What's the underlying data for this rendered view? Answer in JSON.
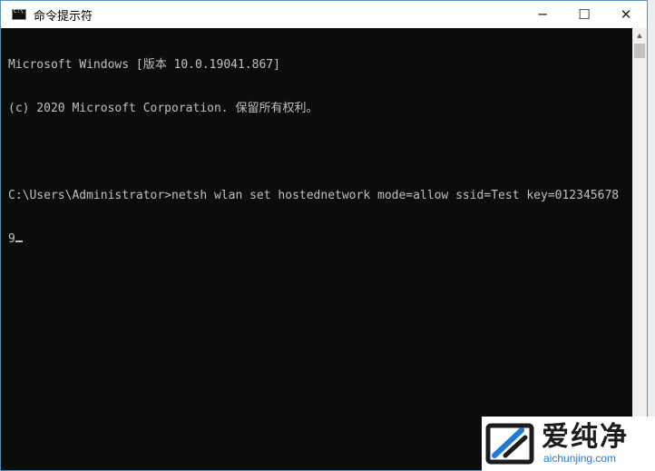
{
  "window": {
    "title": "命令提示符",
    "minimize_symbol": "─",
    "maximize_symbol": "☐",
    "close_symbol": "✕"
  },
  "console": {
    "lines": [
      "Microsoft Windows [版本 10.0.19041.867]",
      "(c) 2020 Microsoft Corporation. 保留所有权利。",
      "",
      "C:\\Users\\Administrator>netsh wlan set hostednetwork mode=allow ssid=Test key=012345678",
      "9"
    ]
  },
  "watermark": {
    "chinese": "爱纯净",
    "url": "aichunjing.com"
  },
  "colors": {
    "console_bg": "#0c0c0c",
    "console_fg": "#c0c0c0",
    "watermark_url": "#1c7bd6"
  }
}
